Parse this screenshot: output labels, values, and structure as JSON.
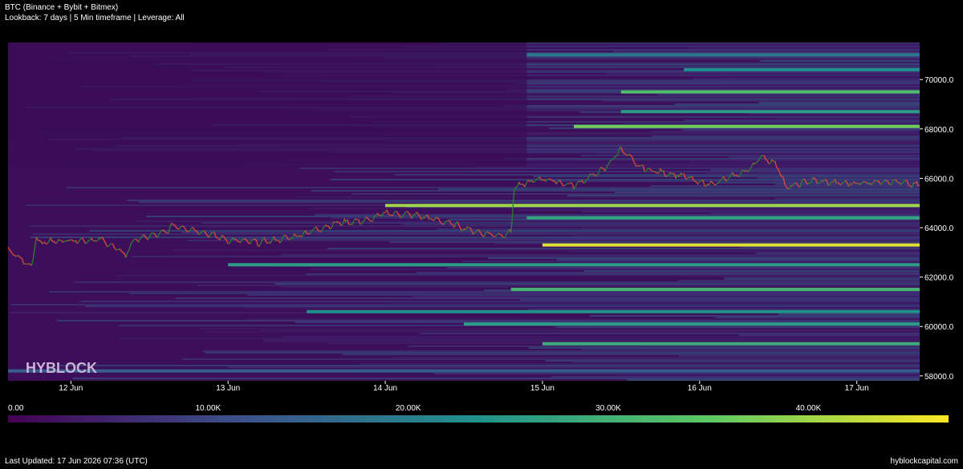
{
  "header": {
    "title": "BTC (Binance + Bybit + Bitmex)",
    "subtitle": "Lookback: 7 days | 5 Min timeframe | Leverage: All"
  },
  "watermark": "HYBLOCK",
  "footer": {
    "last_updated": "Last Updated: 17 Jun 2026 07:36 (UTC)",
    "site": "hyblockcapital.com"
  },
  "colors": {
    "background": "#000000",
    "heatmap_low": "#440154",
    "heatmap_mid": "#21918c",
    "heatmap_high": "#fde725",
    "candle_up": "#2e7d32",
    "candle_down": "#e34a33"
  },
  "chart_data": {
    "type": "heatmap",
    "title": "BTC (Binance + Bybit + Bitmex)",
    "subtitle": "Lookback: 7 days | 5 Min timeframe | Leverage: All",
    "x_ticks": [
      "12 Jun",
      "13 Jun",
      "14 Jun",
      "15 Jun",
      "16 Jun",
      "17 Jun"
    ],
    "y_ticks": [
      "58000.0",
      "60000.0",
      "62000.0",
      "64000.0",
      "66000.0",
      "68000.0",
      "70000.0"
    ],
    "ylim": [
      57800,
      71500
    ],
    "xlim_days": [
      11.6,
      17.4
    ],
    "colorbar": {
      "ticks": [
        "0.00",
        "10.00K",
        "20.00K",
        "30.00K",
        "40.00K"
      ],
      "range": [
        0,
        47000
      ]
    },
    "price_series": {
      "name": "BTC price",
      "x_day": [
        11.6,
        11.75,
        11.78,
        11.8,
        12.0,
        12.2,
        12.35,
        12.4,
        12.6,
        12.65,
        12.8,
        13.0,
        13.2,
        13.4,
        13.6,
        13.7,
        13.9,
        14.0,
        14.2,
        14.4,
        14.6,
        14.72,
        14.8,
        14.82,
        14.9,
        15.0,
        15.2,
        15.4,
        15.5,
        15.55,
        15.6,
        15.7,
        15.9,
        16.0,
        16.1,
        16.3,
        16.4,
        16.5,
        16.55,
        16.7,
        16.9,
        17.0,
        17.2,
        17.4
      ],
      "price": [
        63100,
        62400,
        63700,
        63400,
        63500,
        63500,
        62900,
        63500,
        63800,
        64100,
        63900,
        63500,
        63400,
        63600,
        64000,
        64200,
        64300,
        64600,
        64500,
        64200,
        63800,
        63700,
        63800,
        65600,
        65800,
        66000,
        65700,
        66400,
        67200,
        66900,
        66500,
        66300,
        66100,
        65800,
        65800,
        66300,
        66900,
        66500,
        65600,
        65900,
        65800,
        65800,
        65900,
        65700
      ]
    },
    "liquidity_bands": [
      {
        "price": 58200,
        "intensity": 0.3,
        "from_day": 11.6
      },
      {
        "price": 59300,
        "intensity": 0.62,
        "from_day": 15.0
      },
      {
        "price": 60100,
        "intensity": 0.55,
        "from_day": 14.5
      },
      {
        "price": 60600,
        "intensity": 0.5,
        "from_day": 13.5
      },
      {
        "price": 61500,
        "intensity": 0.66,
        "from_day": 14.8
      },
      {
        "price": 62500,
        "intensity": 0.55,
        "from_day": 13.0
      },
      {
        "price": 63300,
        "intensity": 0.95,
        "from_day": 15.0
      },
      {
        "price": 64400,
        "intensity": 0.58,
        "from_day": 14.9
      },
      {
        "price": 64900,
        "intensity": 0.85,
        "from_day": 14.0
      },
      {
        "price": 68100,
        "intensity": 0.78,
        "from_day": 15.2
      },
      {
        "price": 68700,
        "intensity": 0.55,
        "from_day": 15.5
      },
      {
        "price": 69500,
        "intensity": 0.7,
        "from_day": 15.5
      },
      {
        "price": 70400,
        "intensity": 0.5,
        "from_day": 15.9
      },
      {
        "price": 71000,
        "intensity": 0.4,
        "from_day": 14.9
      }
    ]
  }
}
